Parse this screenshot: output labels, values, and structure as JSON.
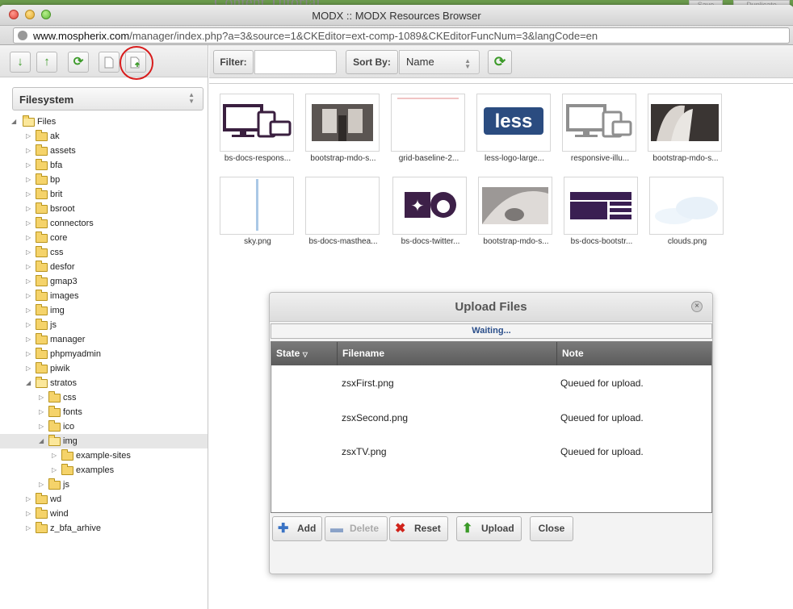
{
  "window": {
    "title": "MODX :: MODX Resources Browser",
    "url_host": "www.mospherix.com",
    "url_path": "/manager/index.php?a=3&source=1&CKEditor=ext-comp-1089&CKEditorFuncNum=3&langCode=en"
  },
  "background": {
    "page_title": "Content Tutorial",
    "save": "Save",
    "duplicate": "Duplicate"
  },
  "left": {
    "source_select": "Filesystem",
    "tree": [
      {
        "label": "Files",
        "level": 0,
        "open": true,
        "expander": "open"
      },
      {
        "label": "ak",
        "level": 1
      },
      {
        "label": "assets",
        "level": 1
      },
      {
        "label": "bfa",
        "level": 1
      },
      {
        "label": "bp",
        "level": 1
      },
      {
        "label": "brit",
        "level": 1
      },
      {
        "label": "bsroot",
        "level": 1
      },
      {
        "label": "connectors",
        "level": 1
      },
      {
        "label": "core",
        "level": 1
      },
      {
        "label": "css",
        "level": 1
      },
      {
        "label": "desfor",
        "level": 1
      },
      {
        "label": "gmap3",
        "level": 1
      },
      {
        "label": "images",
        "level": 1
      },
      {
        "label": "img",
        "level": 1
      },
      {
        "label": "js",
        "level": 1
      },
      {
        "label": "manager",
        "level": 1
      },
      {
        "label": "phpmyadmin",
        "level": 1
      },
      {
        "label": "piwik",
        "level": 1
      },
      {
        "label": "stratos",
        "level": 1,
        "open": true
      },
      {
        "label": "css",
        "level": 2
      },
      {
        "label": "fonts",
        "level": 2
      },
      {
        "label": "ico",
        "level": 2
      },
      {
        "label": "img",
        "level": 2,
        "open": true,
        "selected": true
      },
      {
        "label": "example-sites",
        "level": 3
      },
      {
        "label": "examples",
        "level": 3
      },
      {
        "label": "js",
        "level": 2
      },
      {
        "label": "wd",
        "level": 1
      },
      {
        "label": "wind",
        "level": 1
      },
      {
        "label": "z_bfa_arhive",
        "level": 1
      }
    ]
  },
  "right": {
    "filter_label": "Filter:",
    "filter_value": "",
    "sort_label": "Sort By:",
    "sort_value": "Name",
    "thumbnails": [
      {
        "caption": "bs-docs-respons...",
        "kind": "devices-dark"
      },
      {
        "caption": "bootstrap-mdo-s...",
        "kind": "photo-building"
      },
      {
        "caption": "grid-baseline-2...",
        "kind": "grid-lines"
      },
      {
        "caption": "less-logo-large...",
        "kind": "less-logo"
      },
      {
        "caption": "responsive-illu...",
        "kind": "devices-grey"
      },
      {
        "caption": "bootstrap-mdo-s...",
        "kind": "photo-arch"
      },
      {
        "caption": "sky.png",
        "kind": "sky-line"
      },
      {
        "caption": "bs-docs-masthea...",
        "kind": "blank"
      },
      {
        "caption": "bs-docs-twitter...",
        "kind": "twitter-github"
      },
      {
        "caption": "bootstrap-mdo-s...",
        "kind": "photo-dome"
      },
      {
        "caption": "bs-docs-bootstr...",
        "kind": "bootstrap-layout"
      },
      {
        "caption": "clouds.png",
        "kind": "clouds"
      }
    ]
  },
  "upload": {
    "title": "Upload Files",
    "status": "Waiting...",
    "columns": [
      "State",
      "Filename",
      "Note"
    ],
    "files": [
      {
        "filename": "zsxFirst.png",
        "note": "Queued for upload."
      },
      {
        "filename": "zsxSecond.png",
        "note": "Queued for upload."
      },
      {
        "filename": "zsxTV.png",
        "note": "Queued for upload."
      }
    ],
    "buttons": {
      "add": "Add",
      "delete": "Delete",
      "reset": "Reset",
      "upload": "Upload",
      "close": "Close"
    }
  },
  "colors": {
    "accent_green": "#3b9a28",
    "highlight_red": "#d81c1c",
    "folder": "#f5d36a",
    "status_blue": "#2a4e8a"
  }
}
